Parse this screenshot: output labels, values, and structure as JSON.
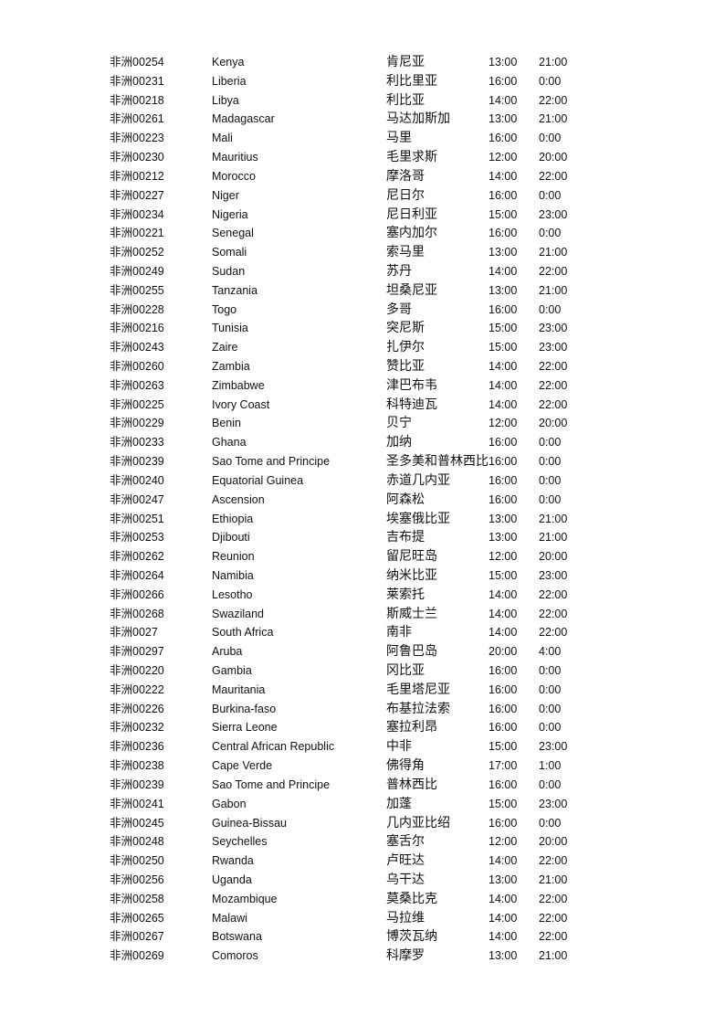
{
  "table": {
    "rows": [
      {
        "code": "非洲00254",
        "country_en": "Kenya",
        "country_zh": "肯尼亚",
        "start": "13:00",
        "end": "21:00"
      },
      {
        "code": "非洲00231",
        "country_en": "Liberia",
        "country_zh": "利比里亚",
        "start": "16:00",
        "end": "0:00"
      },
      {
        "code": "非洲00218",
        "country_en": "Libya",
        "country_zh": "利比亚",
        "start": "14:00",
        "end": "22:00"
      },
      {
        "code": "非洲00261",
        "country_en": "Madagascar",
        "country_zh": "马达加斯加",
        "start": "13:00",
        "end": "21:00"
      },
      {
        "code": "非洲00223",
        "country_en": "Mali",
        "country_zh": "马里",
        "start": "16:00",
        "end": "0:00"
      },
      {
        "code": "非洲00230",
        "country_en": "Mauritius",
        "country_zh": "毛里求斯",
        "start": "12:00",
        "end": "20:00"
      },
      {
        "code": "非洲00212",
        "country_en": "Morocco",
        "country_zh": "摩洛哥",
        "start": "14:00",
        "end": "22:00"
      },
      {
        "code": "非洲00227",
        "country_en": "Niger",
        "country_zh": "尼日尔",
        "start": "16:00",
        "end": "0:00"
      },
      {
        "code": "非洲00234",
        "country_en": "Nigeria",
        "country_zh": "尼日利亚",
        "start": "15:00",
        "end": "23:00"
      },
      {
        "code": "非洲00221",
        "country_en": "Senegal",
        "country_zh": "塞内加尔",
        "start": "16:00",
        "end": "0:00"
      },
      {
        "code": "非洲00252",
        "country_en": "Somali",
        "country_zh": "索马里",
        "start": "13:00",
        "end": "21:00"
      },
      {
        "code": "非洲00249",
        "country_en": "Sudan",
        "country_zh": "苏丹",
        "start": "14:00",
        "end": "22:00"
      },
      {
        "code": "非洲00255",
        "country_en": "Tanzania",
        "country_zh": "坦桑尼亚",
        "start": "13:00",
        "end": "21:00"
      },
      {
        "code": "非洲00228",
        "country_en": "Togo",
        "country_zh": "多哥",
        "start": "16:00",
        "end": "0:00"
      },
      {
        "code": "非洲00216",
        "country_en": "Tunisia",
        "country_zh": "突尼斯",
        "start": "15:00",
        "end": "23:00"
      },
      {
        "code": "非洲00243",
        "country_en": "Zaire",
        "country_zh": "扎伊尔",
        "start": "15:00",
        "end": "23:00"
      },
      {
        "code": "非洲00260",
        "country_en": "Zambia",
        "country_zh": "赞比亚",
        "start": "14:00",
        "end": "22:00"
      },
      {
        "code": "非洲00263",
        "country_en": "Zimbabwe",
        "country_zh": "津巴布韦",
        "start": "14:00",
        "end": "22:00"
      },
      {
        "code": "非洲00225",
        "country_en": "Ivory Coast",
        "country_zh": "科特迪瓦",
        "start": "14:00",
        "end": "22:00"
      },
      {
        "code": "非洲00229",
        "country_en": "Benin",
        "country_zh": "贝宁",
        "start": "12:00",
        "end": "20:00"
      },
      {
        "code": "非洲00233",
        "country_en": "Ghana",
        "country_zh": "加纳",
        "start": "16:00",
        "end": "0:00"
      },
      {
        "code": "非洲00239",
        "country_en": "Sao Tome and Principe",
        "country_zh": "圣多美和普林西比",
        "start": "16:00",
        "end": "0:00"
      },
      {
        "code": "非洲00240",
        "country_en": "Equatorial Guinea",
        "country_zh": "赤道几内亚",
        "start": "16:00",
        "end": "0:00"
      },
      {
        "code": "非洲00247",
        "country_en": "Ascension",
        "country_zh": "阿森松",
        "start": "16:00",
        "end": "0:00"
      },
      {
        "code": "非洲00251",
        "country_en": "Ethiopia",
        "country_zh": "埃塞俄比亚",
        "start": "13:00",
        "end": "21:00"
      },
      {
        "code": "非洲00253",
        "country_en": "Djibouti",
        "country_zh": "吉布提",
        "start": "13:00",
        "end": "21:00"
      },
      {
        "code": "非洲00262",
        "country_en": "Reunion",
        "country_zh": "留尼旺岛",
        "start": "12:00",
        "end": "20:00"
      },
      {
        "code": "非洲00264",
        "country_en": "Namibia",
        "country_zh": "纳米比亚",
        "start": "15:00",
        "end": "23:00"
      },
      {
        "code": "非洲00266",
        "country_en": "Lesotho",
        "country_zh": "莱索托",
        "start": "14:00",
        "end": "22:00"
      },
      {
        "code": "非洲00268",
        "country_en": "Swaziland",
        "country_zh": "斯威士兰",
        "start": "14:00",
        "end": "22:00"
      },
      {
        "code": "非洲0027",
        "country_en": "South Africa",
        "country_zh": "南非",
        "start": "14:00",
        "end": "22:00"
      },
      {
        "code": "非洲00297",
        "country_en": "Aruba",
        "country_zh": "阿鲁巴岛",
        "start": "20:00",
        "end": "4:00"
      },
      {
        "code": "非洲00220",
        "country_en": "Gambia",
        "country_zh": "冈比亚",
        "start": "16:00",
        "end": "0:00"
      },
      {
        "code": "非洲00222",
        "country_en": "Mauritania",
        "country_zh": "毛里塔尼亚",
        "start": "16:00",
        "end": "0:00"
      },
      {
        "code": "非洲00226",
        "country_en": "Burkina-faso",
        "country_zh": "布基拉法索",
        "start": "16:00",
        "end": "0:00"
      },
      {
        "code": "非洲00232",
        "country_en": "Sierra Leone",
        "country_zh": "塞拉利昂",
        "start": "16:00",
        "end": "0:00"
      },
      {
        "code": "非洲00236",
        "country_en": "Central African Republic",
        "country_zh": "中非",
        "start": "15:00",
        "end": "23:00"
      },
      {
        "code": "非洲00238",
        "country_en": "Cape Verde",
        "country_zh": "佛得角",
        "start": "17:00",
        "end": "1:00"
      },
      {
        "code": "非洲00239",
        "country_en": "Sao Tome and Principe",
        "country_zh": "普林西比",
        "start": "16:00",
        "end": "0:00"
      },
      {
        "code": "非洲00241",
        "country_en": "Gabon",
        "country_zh": "加蓬",
        "start": "15:00",
        "end": "23:00"
      },
      {
        "code": "非洲00245",
        "country_en": "Guinea-Bissau",
        "country_zh": "几内亚比绍",
        "start": "16:00",
        "end": "0:00"
      },
      {
        "code": "非洲00248",
        "country_en": "Seychelles",
        "country_zh": "塞舌尔",
        "start": "12:00",
        "end": "20:00"
      },
      {
        "code": "非洲00250",
        "country_en": "Rwanda",
        "country_zh": "卢旺达",
        "start": "14:00",
        "end": "22:00"
      },
      {
        "code": "非洲00256",
        "country_en": "Uganda",
        "country_zh": "乌干达",
        "start": "13:00",
        "end": "21:00"
      },
      {
        "code": "非洲00258",
        "country_en": "Mozambique",
        "country_zh": "莫桑比克",
        "start": "14:00",
        "end": "22:00"
      },
      {
        "code": "非洲00265",
        "country_en": "Malawi",
        "country_zh": "马拉维",
        "start": "14:00",
        "end": "22:00"
      },
      {
        "code": "非洲00267",
        "country_en": "Botswana",
        "country_zh": "博茨瓦纳",
        "start": "14:00",
        "end": "22:00"
      },
      {
        "code": "非洲00269",
        "country_en": "Comoros",
        "country_zh": "科摩罗",
        "start": "13:00",
        "end": "21:00"
      }
    ]
  }
}
